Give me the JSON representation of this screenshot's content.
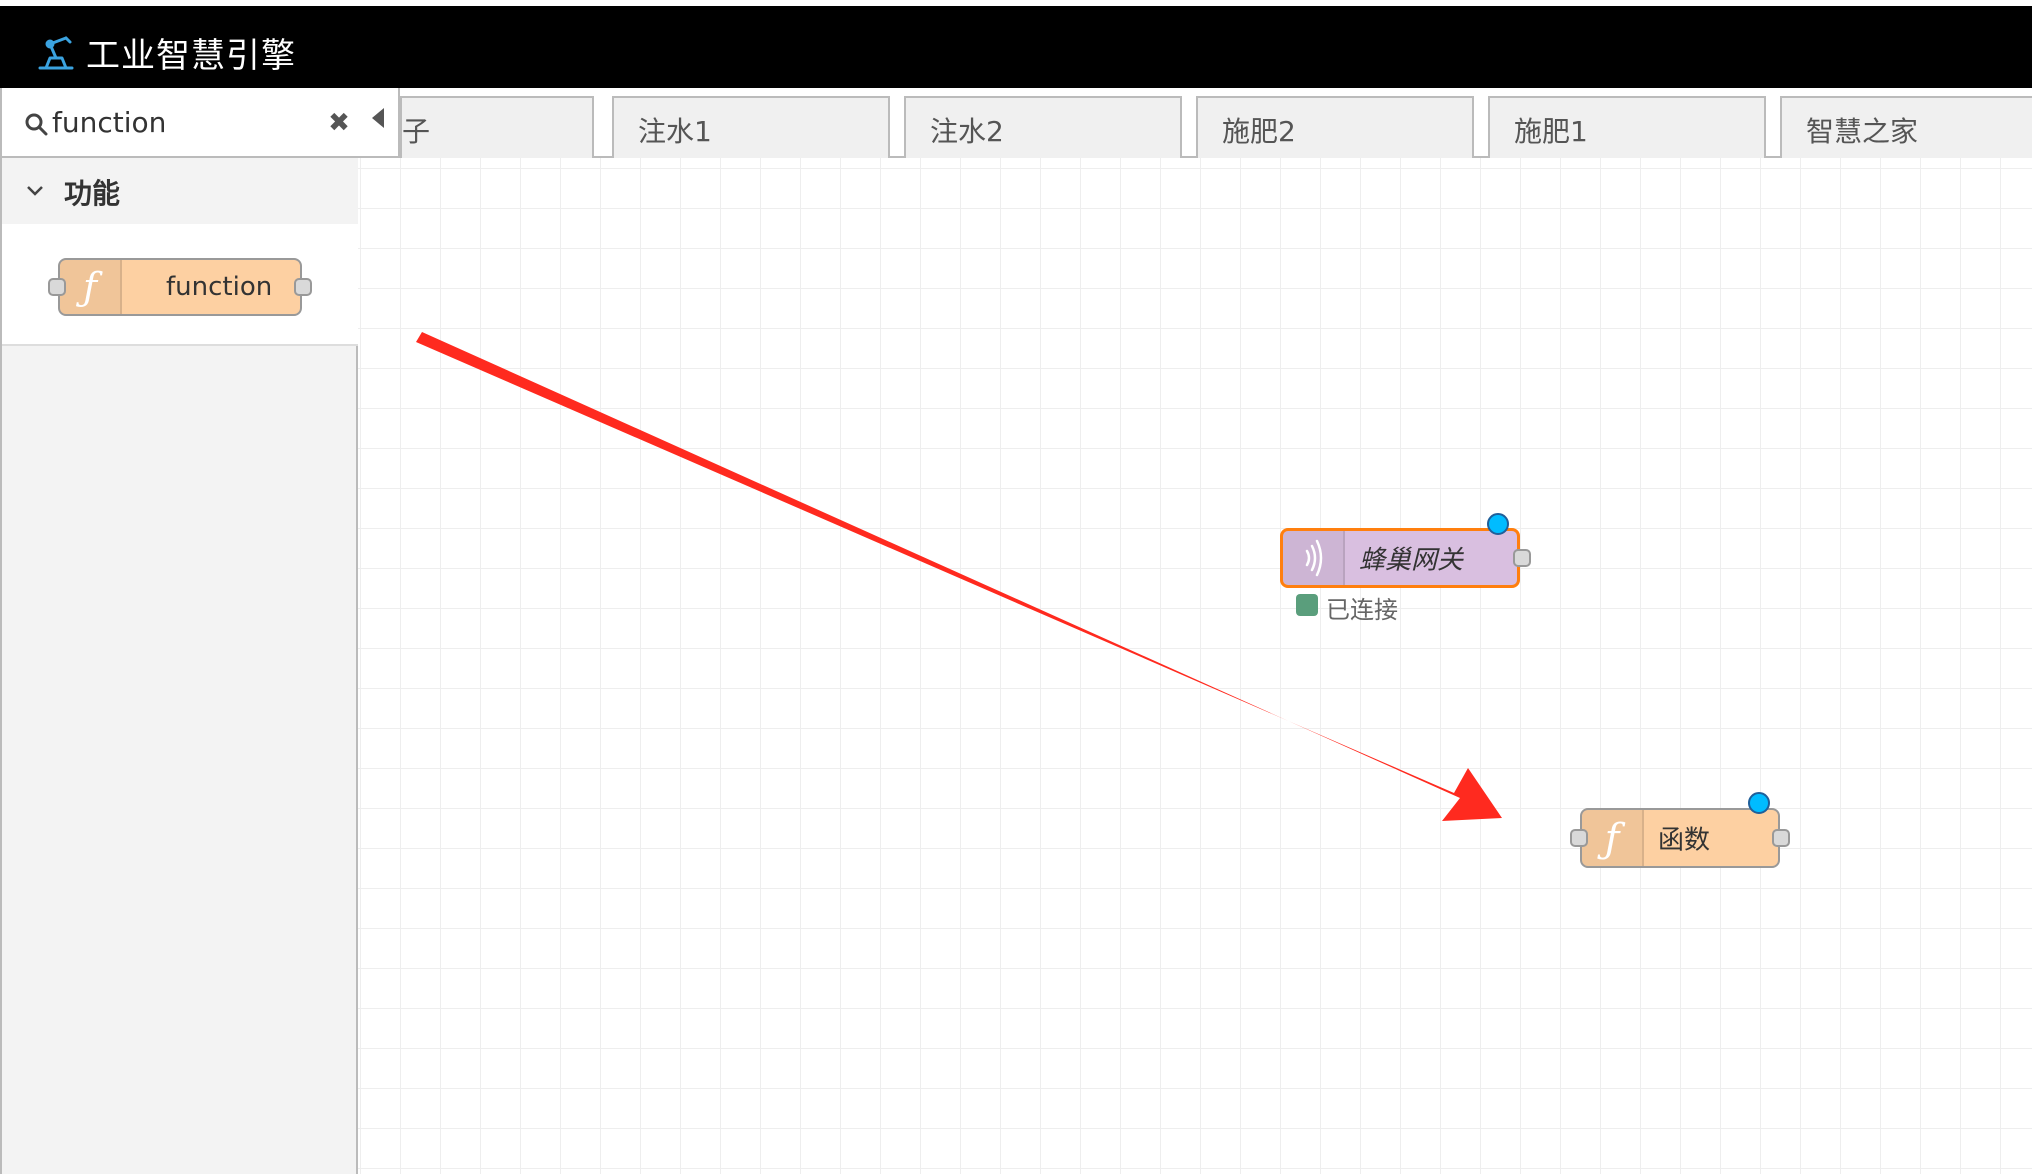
{
  "header": {
    "title": "工业智慧引擎",
    "logo_icon": "robot-arm-icon",
    "background": "#000000"
  },
  "palette": {
    "search": {
      "value": "function",
      "placeholder": ""
    },
    "category": {
      "label": "功能",
      "collapsed": false
    },
    "nodes": [
      {
        "label": "function",
        "icon": "function-icon",
        "color": "#fdd0a2"
      }
    ]
  },
  "tabs": [
    {
      "label": "子"
    },
    {
      "label": "注水1"
    },
    {
      "label": "注水2"
    },
    {
      "label": "施肥2"
    },
    {
      "label": "施肥1"
    },
    {
      "label": "智慧之家"
    }
  ],
  "workspace": {
    "nodes": [
      {
        "label": "蜂巢网关",
        "icon": "wireless-signal-icon",
        "color": "#d9bfe0",
        "status": "已连接",
        "status_color": "#5a9e7c",
        "selected": true
      },
      {
        "label": "函数",
        "icon": "function-icon",
        "color": "#fdd0a2"
      }
    ],
    "annotation": {
      "color": "#ff2a1f"
    }
  }
}
